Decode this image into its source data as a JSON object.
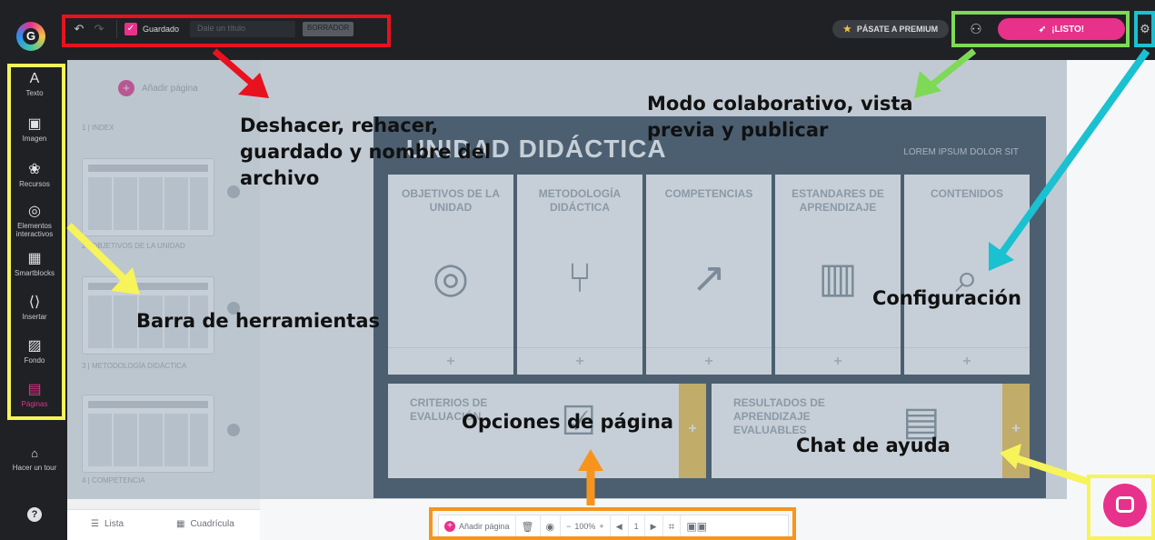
{
  "topbar": {
    "saved_label": "Guardado",
    "filename_placeholder": "Dale un título",
    "draft_badge": "BORRADOR",
    "premium_label": "PÁSATE A PREMIUM",
    "publish_label": "¡LISTO!"
  },
  "sidebar": {
    "items": [
      {
        "label": "Texto",
        "icon": "text-icon"
      },
      {
        "label": "Imagen",
        "icon": "image-icon"
      },
      {
        "label": "Recursos",
        "icon": "resources-icon"
      },
      {
        "label": "Elementos interactivos",
        "icon": "interactive-icon"
      },
      {
        "label": "Smartblocks",
        "icon": "smartblocks-icon"
      },
      {
        "label": "Insertar",
        "icon": "insert-icon"
      },
      {
        "label": "Fondo",
        "icon": "background-icon"
      },
      {
        "label": "Páginas",
        "icon": "pages-icon",
        "active": true
      }
    ],
    "tour_label": "Hacer un tour",
    "help_label": "?"
  },
  "pages_panel": {
    "add_page_label": "Añadir página",
    "pages": [
      {
        "label": "1 | INDEX"
      },
      {
        "label": "2 | OBJETIVOS DE LA UNIDAD"
      },
      {
        "label": "3 | METODOLOGÍA DIDÁCTICA"
      },
      {
        "label": "4 | COMPETENCIA"
      }
    ],
    "list_label": "Lista",
    "grid_label": "Cuadrícula"
  },
  "slide": {
    "title": "UNIDAD DIDÁCTICA",
    "subtitle": "LOREM IPSUM DOLOR SIT",
    "top_cards": [
      {
        "title": "OBJETIVOS DE LA UNIDAD",
        "icon": "target-icon"
      },
      {
        "title": "METODOLOGÍA DIDÁCTICA",
        "icon": "branch-icon"
      },
      {
        "title": "COMPETENCIAS",
        "icon": "growth-chart-icon"
      },
      {
        "title": "ESTANDARES DE APRENDIZAJE",
        "icon": "book-icon"
      },
      {
        "title": "CONTENIDOS",
        "icon": "search-doc-icon"
      }
    ],
    "bottom_cards": [
      {
        "title": "CRITERIOS DE EVALUACIÓN",
        "icon": "checklist-icon"
      },
      {
        "title": "RESULTADOS DE APRENDIZAJE EVALUABLES",
        "icon": "doc-icon"
      }
    ],
    "plus": "+"
  },
  "bottom_toolbar": {
    "add_page_label": "Añadir página",
    "zoom": "100%",
    "page_number": "1"
  },
  "annotations": {
    "undo_redo": "Deshacer, rehacer, guardado y nombre del archivo",
    "collab": "Modo colaborativo, vista previa y publicar",
    "config": "Configuración",
    "toolbar": "Barra de herramientas",
    "page_options": "Opciones de página",
    "chat": "Chat de ayuda"
  },
  "colors": {
    "brand_pink": "#e8318b",
    "frame_red": "#e8121e",
    "frame_green": "#7ed957",
    "frame_cyan": "#1ac1d0",
    "frame_yellow": "#f7f35a",
    "frame_orange": "#f7941d"
  }
}
